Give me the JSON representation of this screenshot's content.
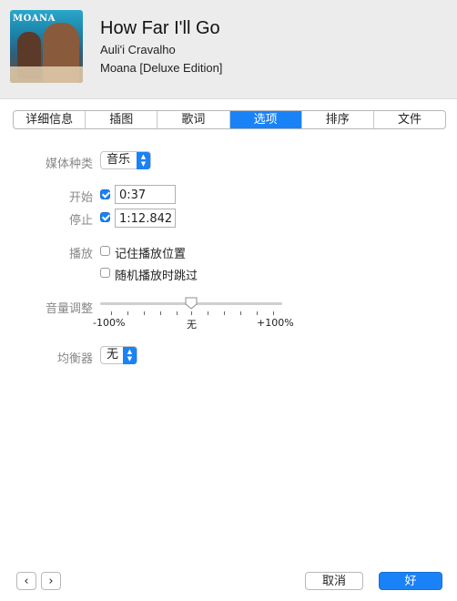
{
  "header": {
    "song_title": "How Far I'll Go",
    "artist": "Auli'i Cravalho",
    "album": "Moana [Deluxe Edition]",
    "art_text": "MOANA"
  },
  "tabs": [
    {
      "label": "详细信息",
      "active": false
    },
    {
      "label": "插图",
      "active": false
    },
    {
      "label": "歌词",
      "active": false
    },
    {
      "label": "选项",
      "active": true
    },
    {
      "label": "排序",
      "active": false
    },
    {
      "label": "文件",
      "active": false
    }
  ],
  "options": {
    "media_kind_label": "媒体种类",
    "media_kind_value": "音乐",
    "start_label": "开始",
    "start_checked": true,
    "start_value": "0:37",
    "stop_label": "停止",
    "stop_checked": true,
    "stop_value": "1:12.842",
    "playback_label": "播放",
    "remember_position_label": "记住播放位置",
    "remember_position_checked": false,
    "skip_shuffle_label": "随机播放时跳过",
    "skip_shuffle_checked": false,
    "volume_label": "音量调整",
    "volume_min_label": "-100%",
    "volume_mid_label": "无",
    "volume_max_label": "+100%",
    "volume_value_percent": 0,
    "eq_label": "均衡器",
    "eq_value": "无"
  },
  "footer": {
    "prev_icon": "chevron-left-icon",
    "next_icon": "chevron-right-icon",
    "prev_glyph": "‹",
    "next_glyph": "›",
    "cancel_label": "取消",
    "ok_label": "好"
  },
  "colors": {
    "accent": "#1a82f7",
    "header_bg": "#ececec",
    "label_gray": "#888888"
  }
}
